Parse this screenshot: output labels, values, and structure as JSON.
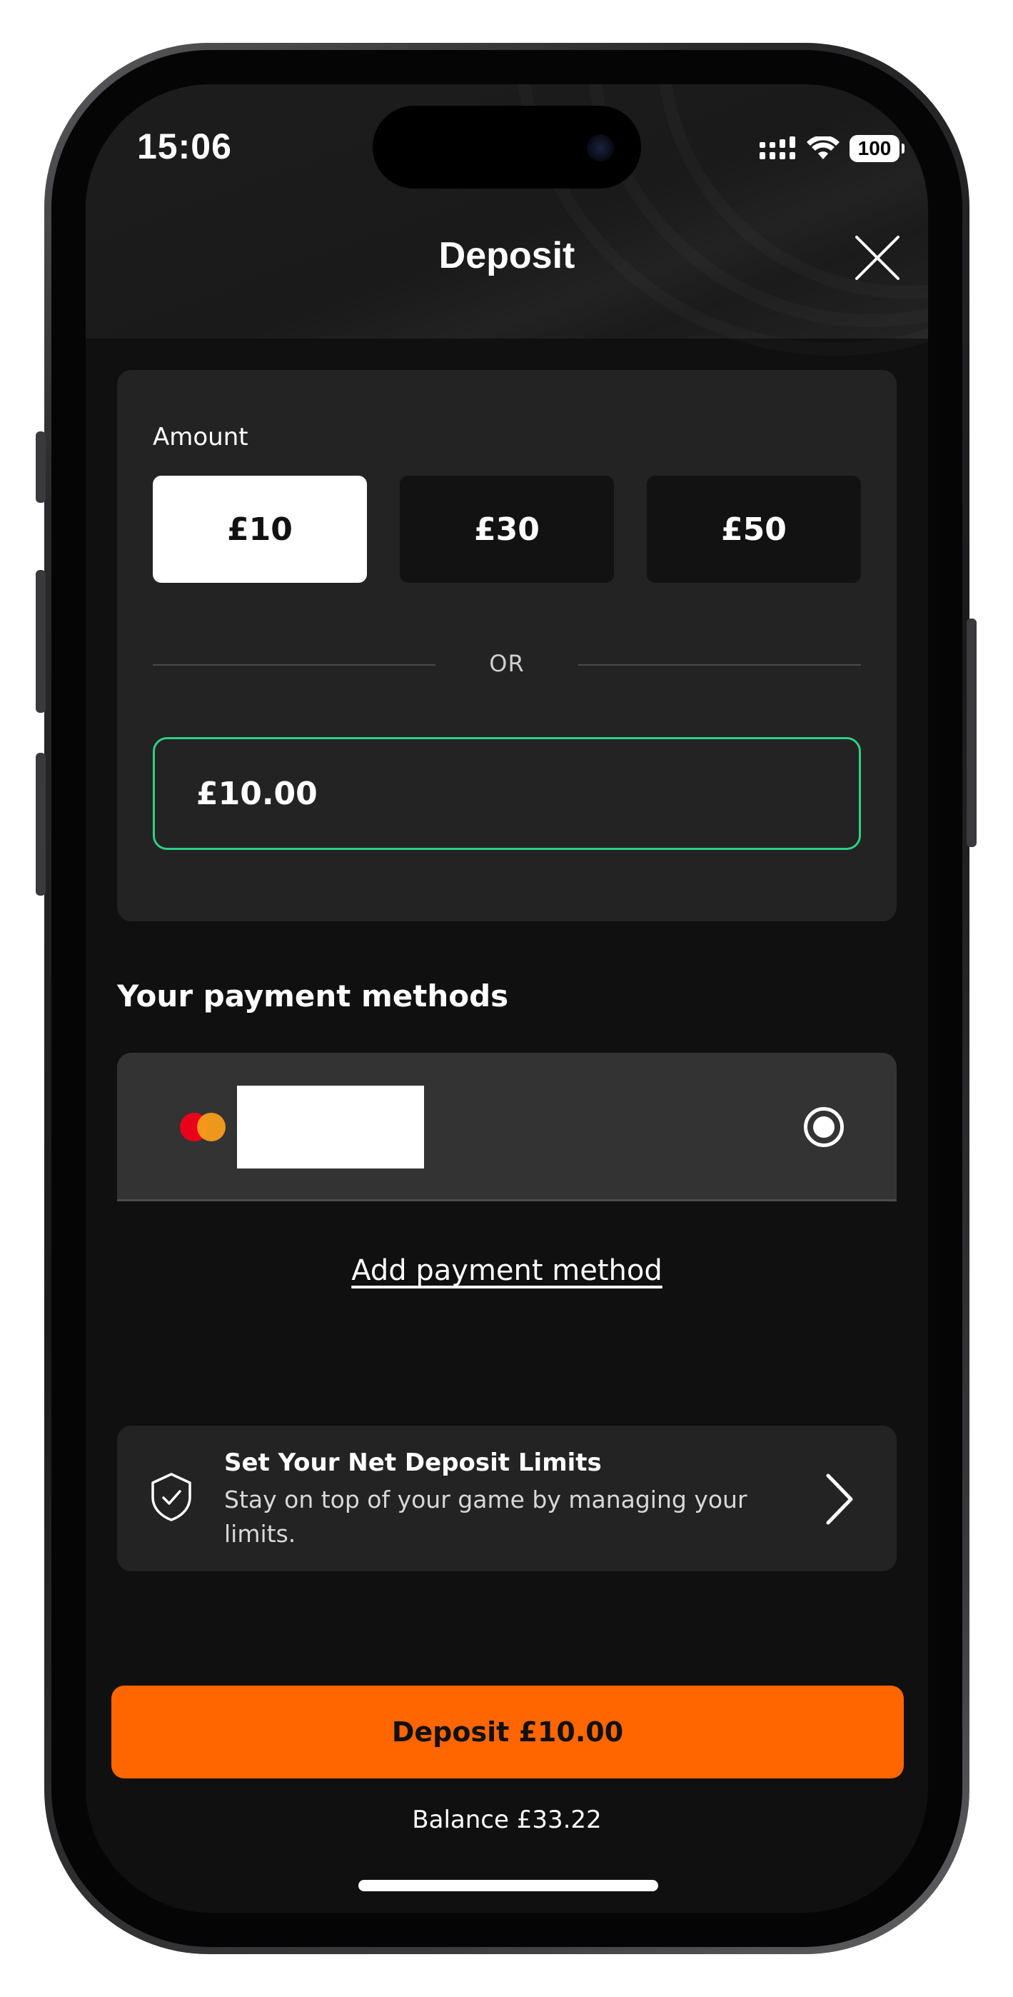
{
  "status_bar": {
    "time": "15:06",
    "battery": "100",
    "icons": [
      "signal-icon",
      "wifi-icon",
      "battery-icon"
    ]
  },
  "header": {
    "title": "Deposit",
    "close_icon": "close-icon"
  },
  "amount": {
    "label": "Amount",
    "presets": [
      {
        "label": "£10",
        "selected": true
      },
      {
        "label": "£30",
        "selected": false
      },
      {
        "label": "£50",
        "selected": false
      }
    ],
    "divider_text": "OR",
    "input_value": "£10.00"
  },
  "payment_methods": {
    "title": "Your payment methods",
    "card_brand_icon": "mastercard-icon",
    "selected": true,
    "add_label": "Add payment method"
  },
  "limits": {
    "title": "Set Your Net Deposit Limits",
    "subtitle": "Stay on top of your game by managing your limits.",
    "icon": "shield-check-icon"
  },
  "footer": {
    "deposit_button": "Deposit £10.00",
    "balance": "Balance £33.22"
  },
  "colors": {
    "background": "#101010",
    "card": "#232323",
    "accent_orange": "#ff6600",
    "input_border_green": "#2ecf86"
  }
}
